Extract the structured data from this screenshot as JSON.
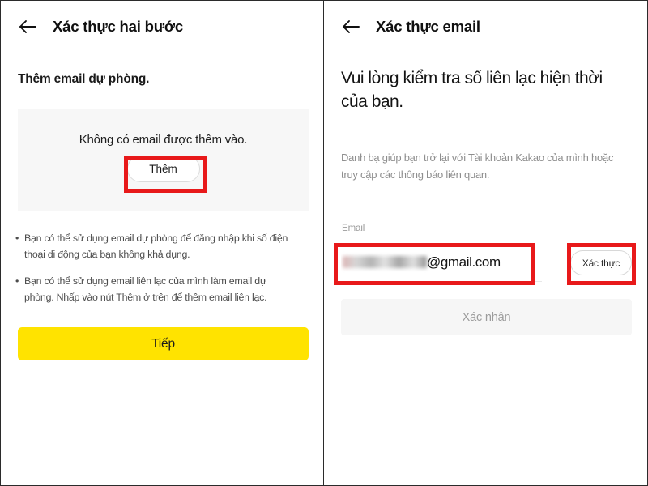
{
  "theme": {
    "accent_yellow": "#ffe300",
    "highlight_red": "#e8191a",
    "card_gray": "#f7f7f7",
    "disabled_button_gray": "#f6f6f6",
    "text_primary": "#131313",
    "text_muted": "#8e8e8e"
  },
  "left_screen": {
    "back_icon": "arrow-left-icon",
    "title": "Xác thực hai bước",
    "subtitle": "Thêm email dự phòng.",
    "empty_card": {
      "message": "Không có email được thêm vào.",
      "add_button_label": "Thêm"
    },
    "bullets": [
      "Bạn có thể sử dụng email dự phòng để đăng nhập khi số điện thoại di động của bạn không khả dụng.",
      "Bạn có thể sử dụng email liên lạc của mình làm email dự phòng. Nhấp vào nút Thêm ở trên để thêm email liên lạc."
    ],
    "continue_button_label": "Tiếp"
  },
  "right_screen": {
    "back_icon": "arrow-left-icon",
    "title": "Xác thực email",
    "heading": "Vui lòng kiểm tra số liên lạc hiện thời của bạn.",
    "description": "Danh bạ giúp bạn trở lại với Tài khoản Kakao của mình hoặc truy cập các thông báo liên quan.",
    "email_field": {
      "label": "Email",
      "value_suffix": "@gmail.com",
      "value_redacted": true,
      "placeholder": "Email"
    },
    "verify_button_label": "Xác thực",
    "confirm_button_label": "Xác nhận"
  },
  "annotations": {
    "highlight_boxes": [
      {
        "name": "add-button-highlight",
        "target": "Thêm"
      },
      {
        "name": "email-input-highlight",
        "target": "@gmail.com"
      },
      {
        "name": "verify-button-highlight",
        "target": "Xác thực"
      }
    ]
  }
}
